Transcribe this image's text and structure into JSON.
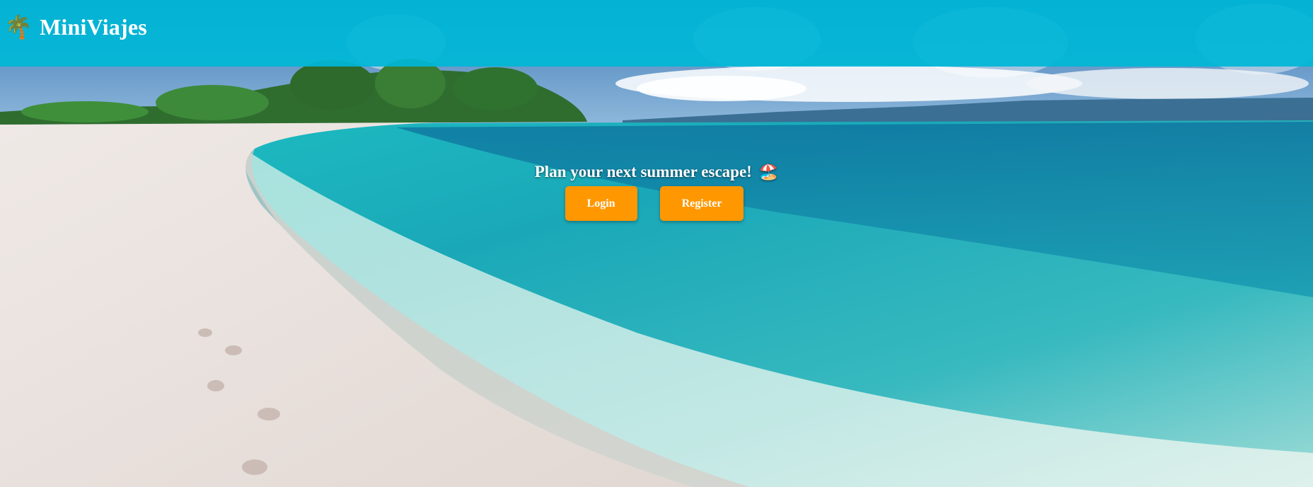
{
  "header": {
    "logo_icon": "🌴",
    "logo_icon_name": "palm-tree-icon",
    "title": "MiniViajes",
    "background_color": "#00b7d6"
  },
  "hero": {
    "tagline": "Plan your next summer escape!",
    "tagline_icon": "🏖️",
    "tagline_icon_name": "beach-umbrella-icon",
    "login_label": "Login",
    "register_label": "Register",
    "button_color": "#ff9800"
  }
}
